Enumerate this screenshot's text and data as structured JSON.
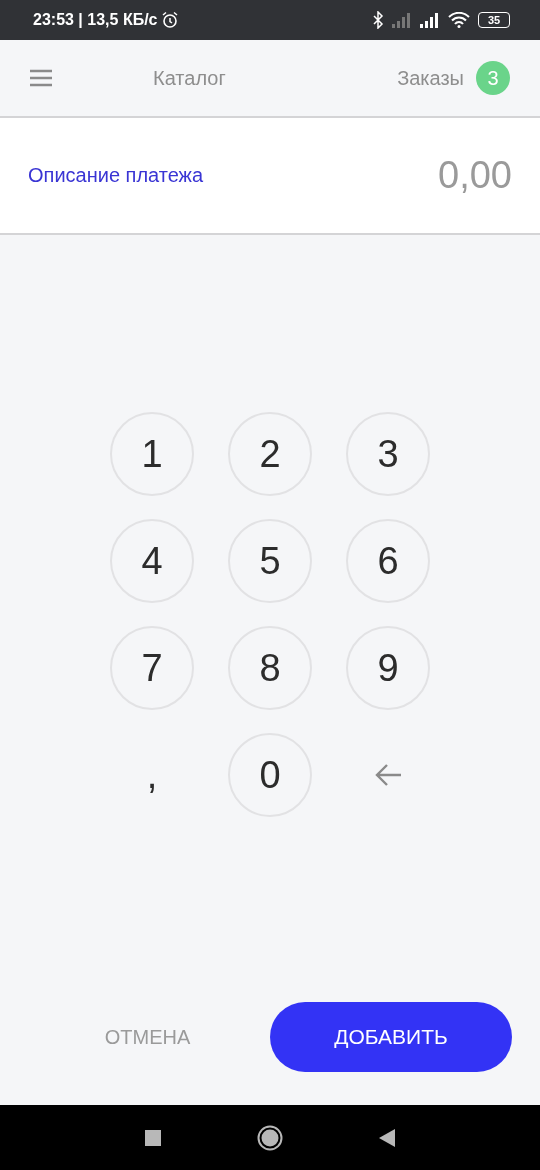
{
  "status_bar": {
    "time": "23:53 | 13,5 КБ/с",
    "battery": "35"
  },
  "header": {
    "catalog": "Каталог",
    "orders": "Заказы",
    "orders_count": "3"
  },
  "payment": {
    "description_placeholder": "Описание платежа",
    "amount": "0,00"
  },
  "keypad": [
    {
      "kind": "digit",
      "label": "1"
    },
    {
      "kind": "digit",
      "label": "2"
    },
    {
      "kind": "digit",
      "label": "3"
    },
    {
      "kind": "digit",
      "label": "4"
    },
    {
      "kind": "digit",
      "label": "5"
    },
    {
      "kind": "digit",
      "label": "6"
    },
    {
      "kind": "digit",
      "label": "7"
    },
    {
      "kind": "digit",
      "label": "8"
    },
    {
      "kind": "digit",
      "label": "9"
    },
    {
      "kind": "comma",
      "label": ","
    },
    {
      "kind": "digit",
      "label": "0"
    },
    {
      "kind": "backspace"
    }
  ],
  "buttons": {
    "cancel": "ОТМЕНА",
    "add": "ДОБАВИТЬ"
  }
}
